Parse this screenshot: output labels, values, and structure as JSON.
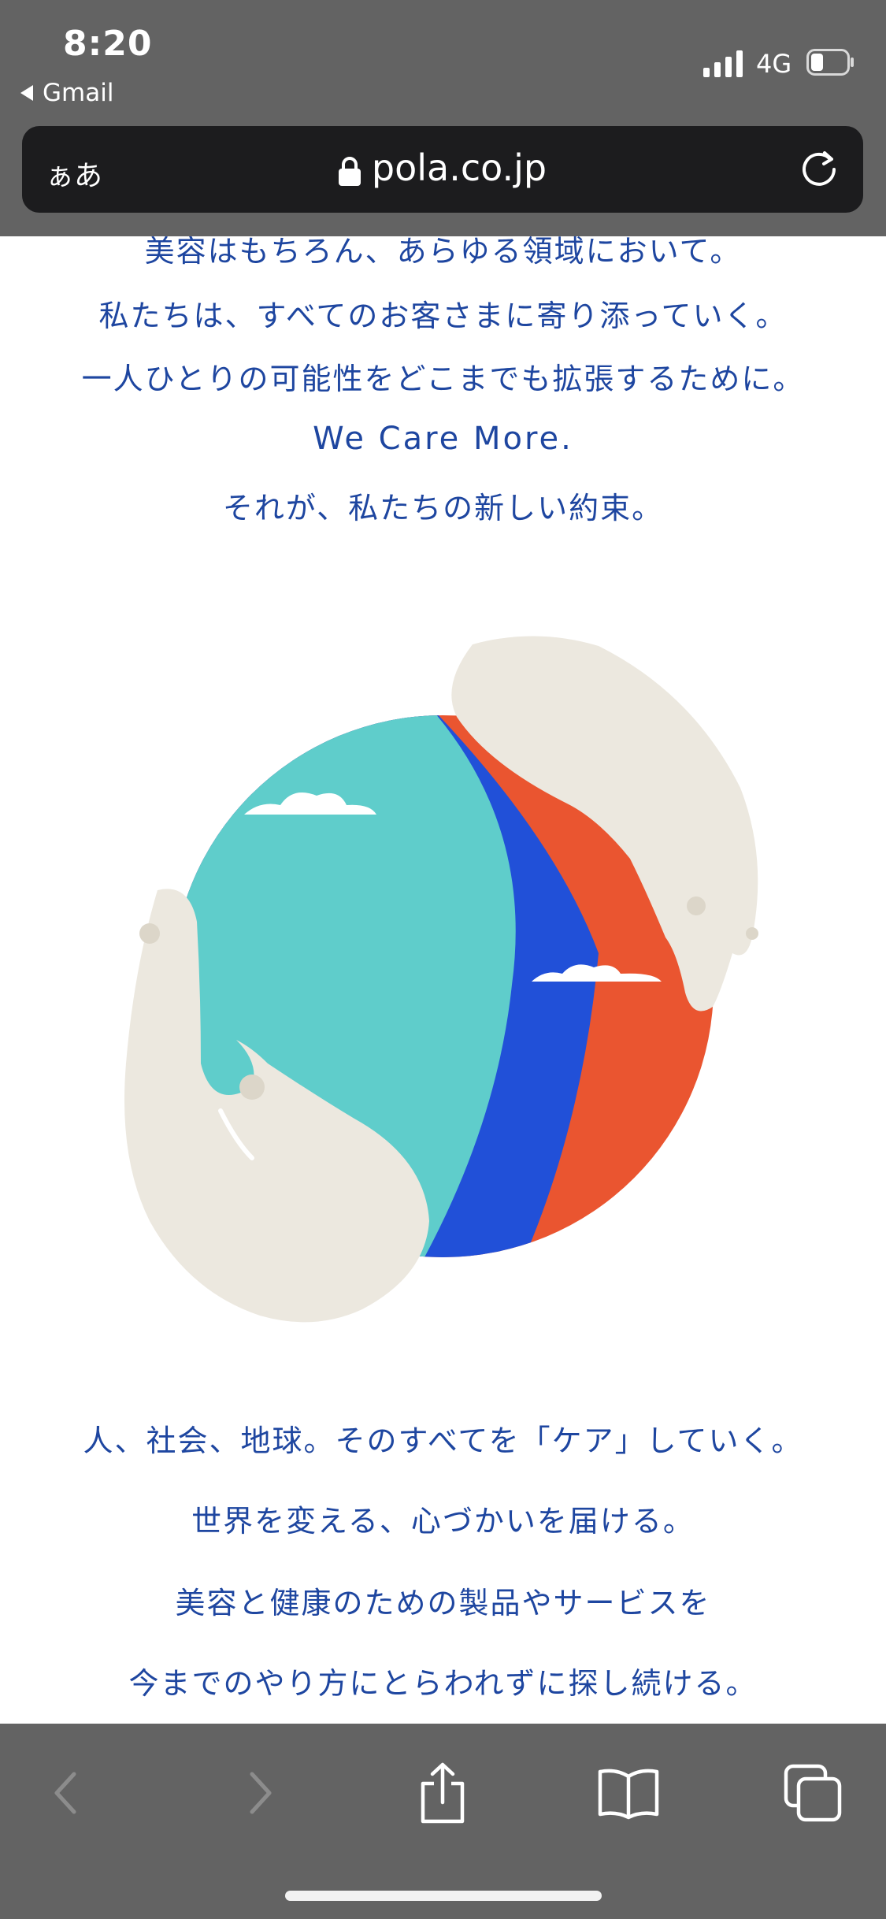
{
  "status": {
    "time": "8:20",
    "back_app": "Gmail",
    "network": "4G"
  },
  "browser": {
    "text_size_label": "ぁあ",
    "url": "pola.co.jp"
  },
  "content": {
    "lines_top": [
      "美容はもちろん、あらゆる領域において。",
      "私たちは、すべてのお客さまに寄り添っていく。",
      "一人ひとりの可能性をどこまでも拡張するために。",
      "We Care More.",
      "それが、私たちの新しい約束。"
    ],
    "lines_bottom": [
      "人、社会、地球。そのすべてを「ケア」していく。",
      "世界を変える、心づかいを届ける。",
      "美容と健康のための製品やサービスを",
      "今までのやり方にとらわれずに探し続ける。"
    ]
  },
  "colors": {
    "text_blue": "#1e46a0",
    "globe_teal": "#5fcdcb",
    "globe_blue": "#2150d8",
    "globe_orange": "#ea5530",
    "hand_cream": "#ece8df",
    "chrome_gray": "#636363"
  },
  "icons": {
    "toolbar": [
      "back-arrow-icon",
      "forward-arrow-icon",
      "share-icon",
      "bookmarks-icon",
      "tabs-icon"
    ]
  }
}
